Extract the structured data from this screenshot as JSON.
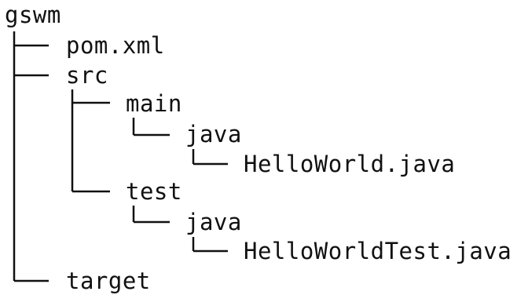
{
  "tree": {
    "root": "gswm",
    "pom": "pom.xml",
    "src": "src",
    "main": "main",
    "main_java": "java",
    "main_file": "HelloWorld.java",
    "test": "test",
    "test_java": "java",
    "test_file": "HelloWorldTest.java",
    "target": "target"
  }
}
